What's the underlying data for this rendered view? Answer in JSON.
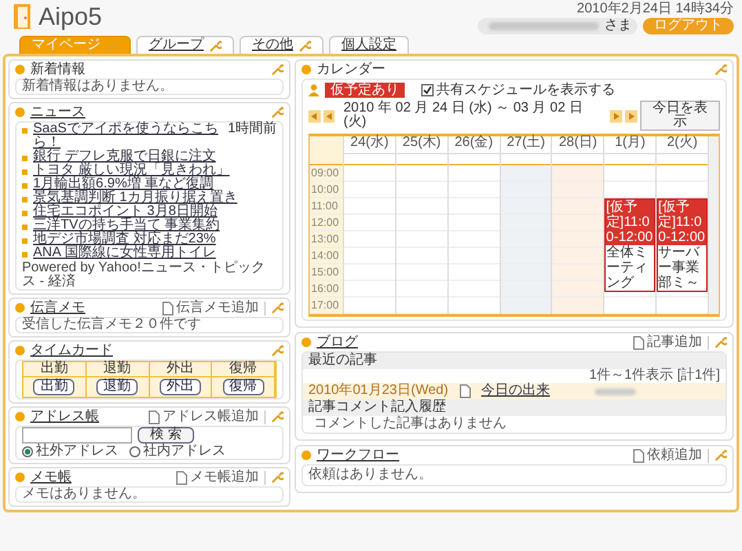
{
  "header": {
    "logo": "Aipo5",
    "datetime": "2010年2月24日 14時34分",
    "user_suffix": "さま",
    "logout": "ログアウト"
  },
  "tabs": [
    {
      "label": "マイページ",
      "selected": true,
      "wrench": true
    },
    {
      "label": "グループ",
      "selected": false,
      "wrench": true
    },
    {
      "label": "その他",
      "selected": false,
      "wrench": true
    },
    {
      "label": "個人設定",
      "selected": false,
      "wrench": false
    }
  ],
  "left": [
    {
      "kind": "text",
      "title": "新着情報",
      "link": false,
      "text": "新着情報はありません。"
    },
    {
      "kind": "news",
      "title": "ニュース",
      "link": true,
      "items": [
        {
          "text": "SaaSでアイポを使うならこちら！",
          "time": "1時間前"
        },
        {
          "text": "銀行 デフレ克服で日銀に注文"
        },
        {
          "text": "トヨタ 厳しい現況「見きわれ」"
        },
        {
          "text": "1月輸出額6.9%増 車など復調"
        },
        {
          "text": "景気基調判断 1カ月振り据え置き"
        },
        {
          "text": "住宅エコポイント 3月8日開始"
        },
        {
          "text": "三洋TVの持ち手当て 事業集約"
        },
        {
          "text": "地デジ市場調査 対応まだ23%"
        },
        {
          "text": "ANA 国際線に女性専用トイレ"
        }
      ],
      "credit": "Powered by Yahoo!ニュース・トピックス - 経済"
    },
    {
      "kind": "text",
      "title": "伝言メモ",
      "link": true,
      "add": "伝言メモ追加",
      "text": "受信した伝言メモ２０件です"
    },
    {
      "kind": "timecard",
      "title": "タイムカード",
      "link": true,
      "columns": [
        "出勤",
        "退勤",
        "外出",
        "復帰"
      ],
      "buttons": [
        "出勤",
        "退勤",
        "外出",
        "復帰"
      ]
    },
    {
      "kind": "address",
      "title": "アドレス帳",
      "link": true,
      "add": "アドレス帳追加",
      "search": "検 索",
      "options": [
        {
          "label": "社外アドレス",
          "selected": true
        },
        {
          "label": "社内アドレス",
          "selected": false
        }
      ]
    },
    {
      "kind": "text",
      "title": "メモ帳",
      "link": true,
      "add": "メモ帳追加",
      "text": "メモはありません。"
    }
  ],
  "calendar": {
    "title": "カレンダー",
    "badge": "仮予定あり",
    "range": "2010 年 02 月 24 日 (水) ～ 03 月 02 日 (火)",
    "today": "今日を表示",
    "shared": {
      "label": "共有スケジュールを表示する",
      "checked": true
    },
    "days": [
      {
        "label": "24(水)",
        "kind": "weekday"
      },
      {
        "label": "25(木)",
        "kind": "weekday"
      },
      {
        "label": "26(金)",
        "kind": "weekday"
      },
      {
        "label": "27(土)",
        "kind": "saturday"
      },
      {
        "label": "28(日)",
        "kind": "sunday"
      },
      {
        "label": "1(月)",
        "kind": "weekday",
        "events": [
          {
            "header": "[仮予定]11:00-12:00",
            "title": "全体ミーティング"
          }
        ]
      },
      {
        "label": "2(火)",
        "kind": "weekday",
        "events": [
          {
            "header": "[仮予定]11:00-12:00",
            "title": "サーバー事業部ミ～"
          }
        ]
      }
    ],
    "times": [
      "09:00",
      "10:00",
      "11:00",
      "12:00",
      "13:00",
      "14:00",
      "15:00",
      "16:00",
      "17:00"
    ]
  },
  "blog": {
    "title": "ブログ",
    "add": "記事追加",
    "recent": "最近の記事",
    "count": "1件～1件表示 [計1件]",
    "entries": [
      {
        "date": "2010年01月23日(Wed)",
        "title": "今日の出来"
      }
    ],
    "comments_heading": "記事コメント記入履歴",
    "no_comments": "コメントした記事はありません"
  },
  "workflow": {
    "title": "ワークフロー",
    "add": "依頼追加",
    "text": "依頼はありません。"
  }
}
